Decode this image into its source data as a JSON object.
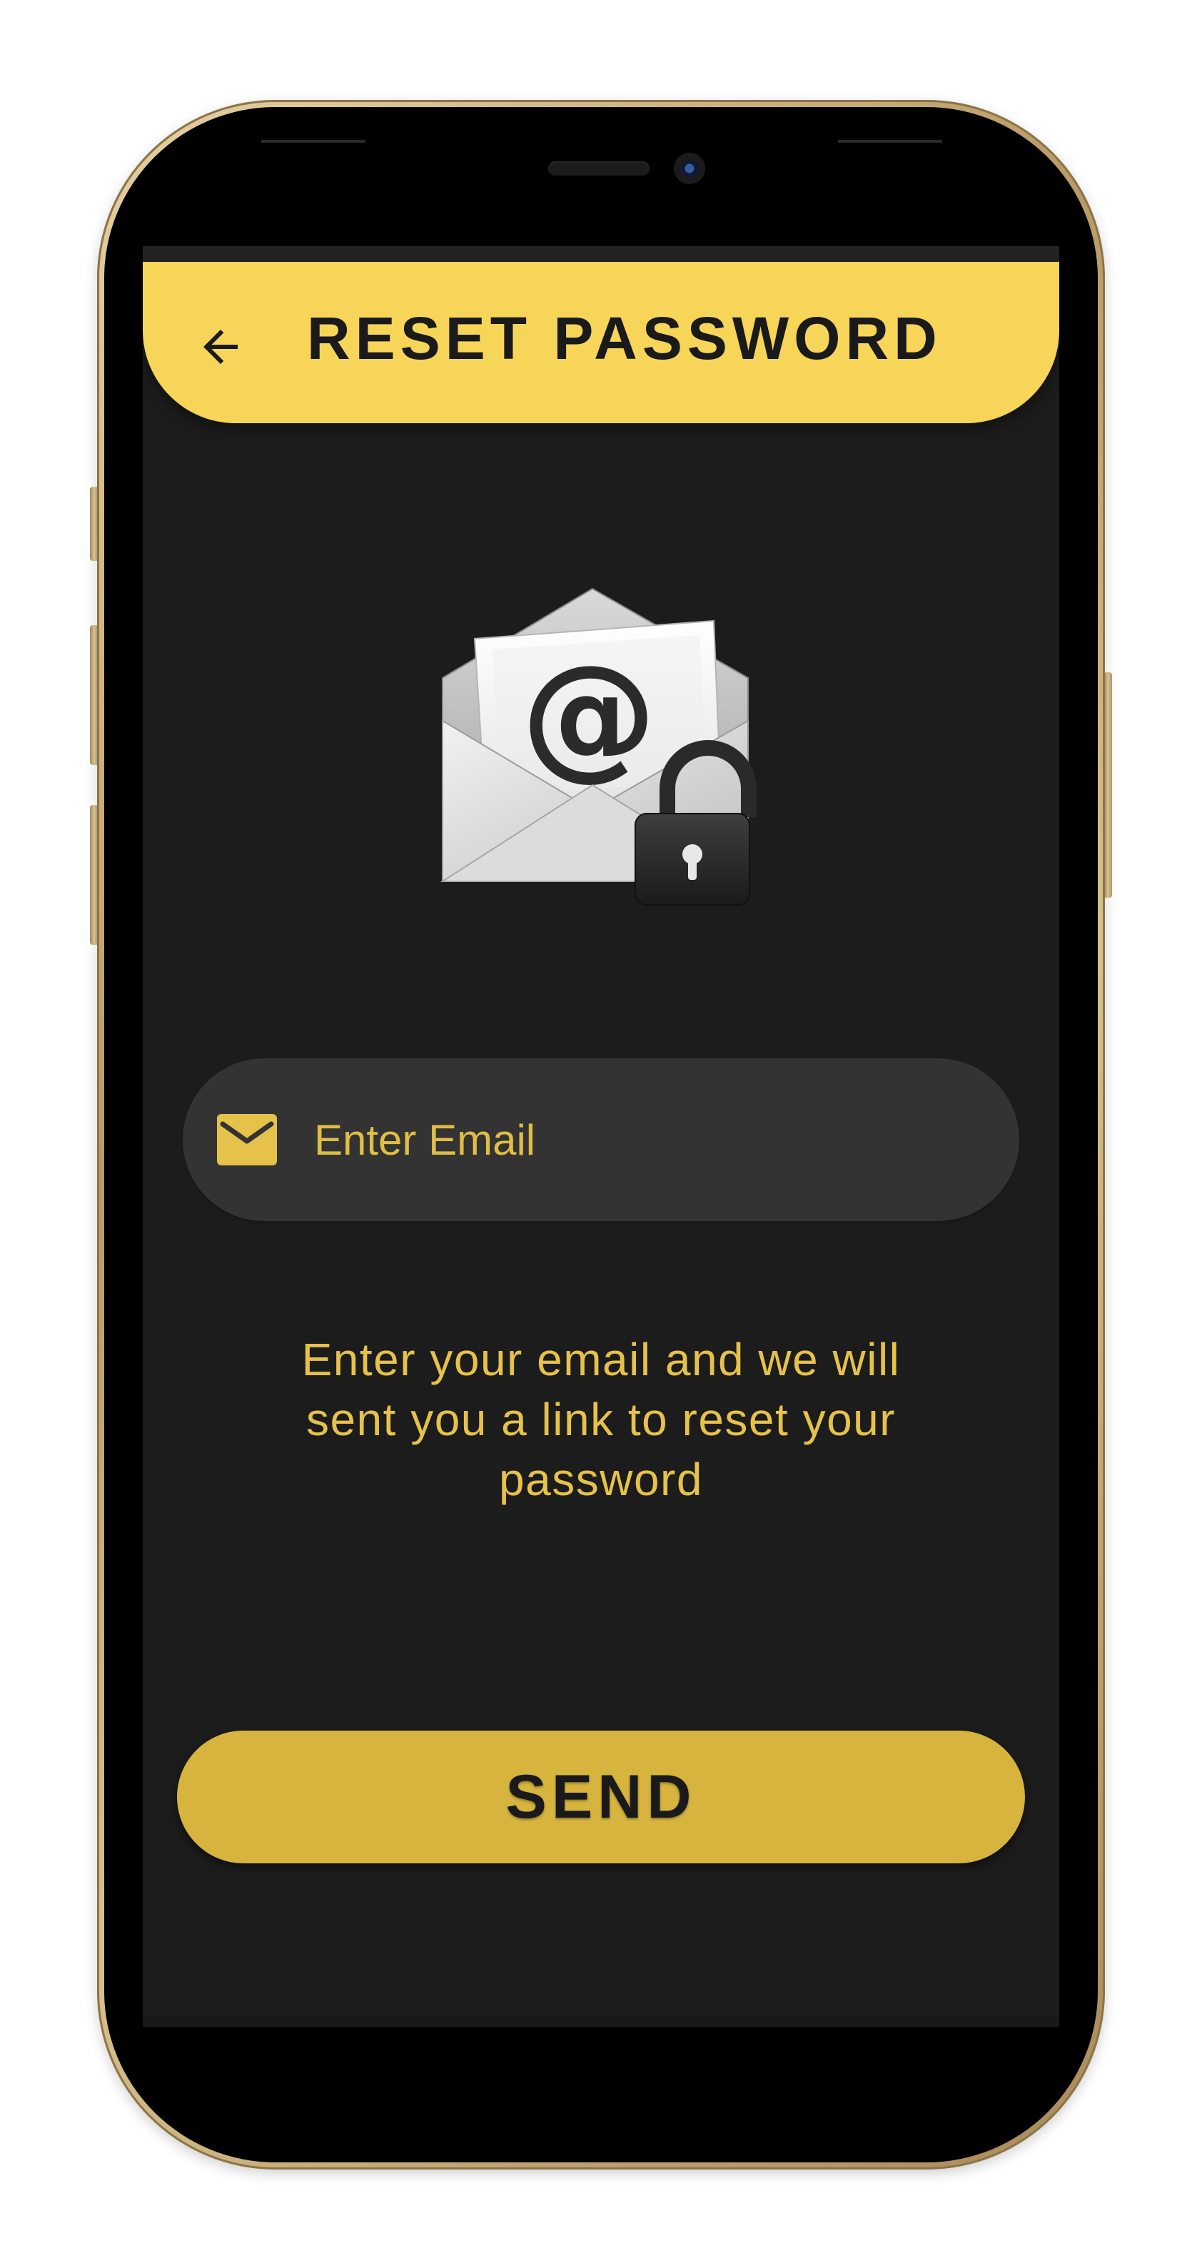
{
  "header": {
    "title": "RESET PASSWORD",
    "back_icon": "arrow-left-icon",
    "color": "#f6d558"
  },
  "illustration": {
    "icon": "email-lock-icon",
    "symbol": "@"
  },
  "email_field": {
    "placeholder": "Enter Email",
    "value": "",
    "icon": "mail-icon"
  },
  "helper": {
    "line1": "Enter your email and we will",
    "line2": "sent you a link to reset your",
    "line3": "password"
  },
  "send_button": {
    "label": "SEND",
    "color": "#d6b43e"
  },
  "theme": {
    "background": "#1c1c1c",
    "accent": "#e6c24a"
  }
}
